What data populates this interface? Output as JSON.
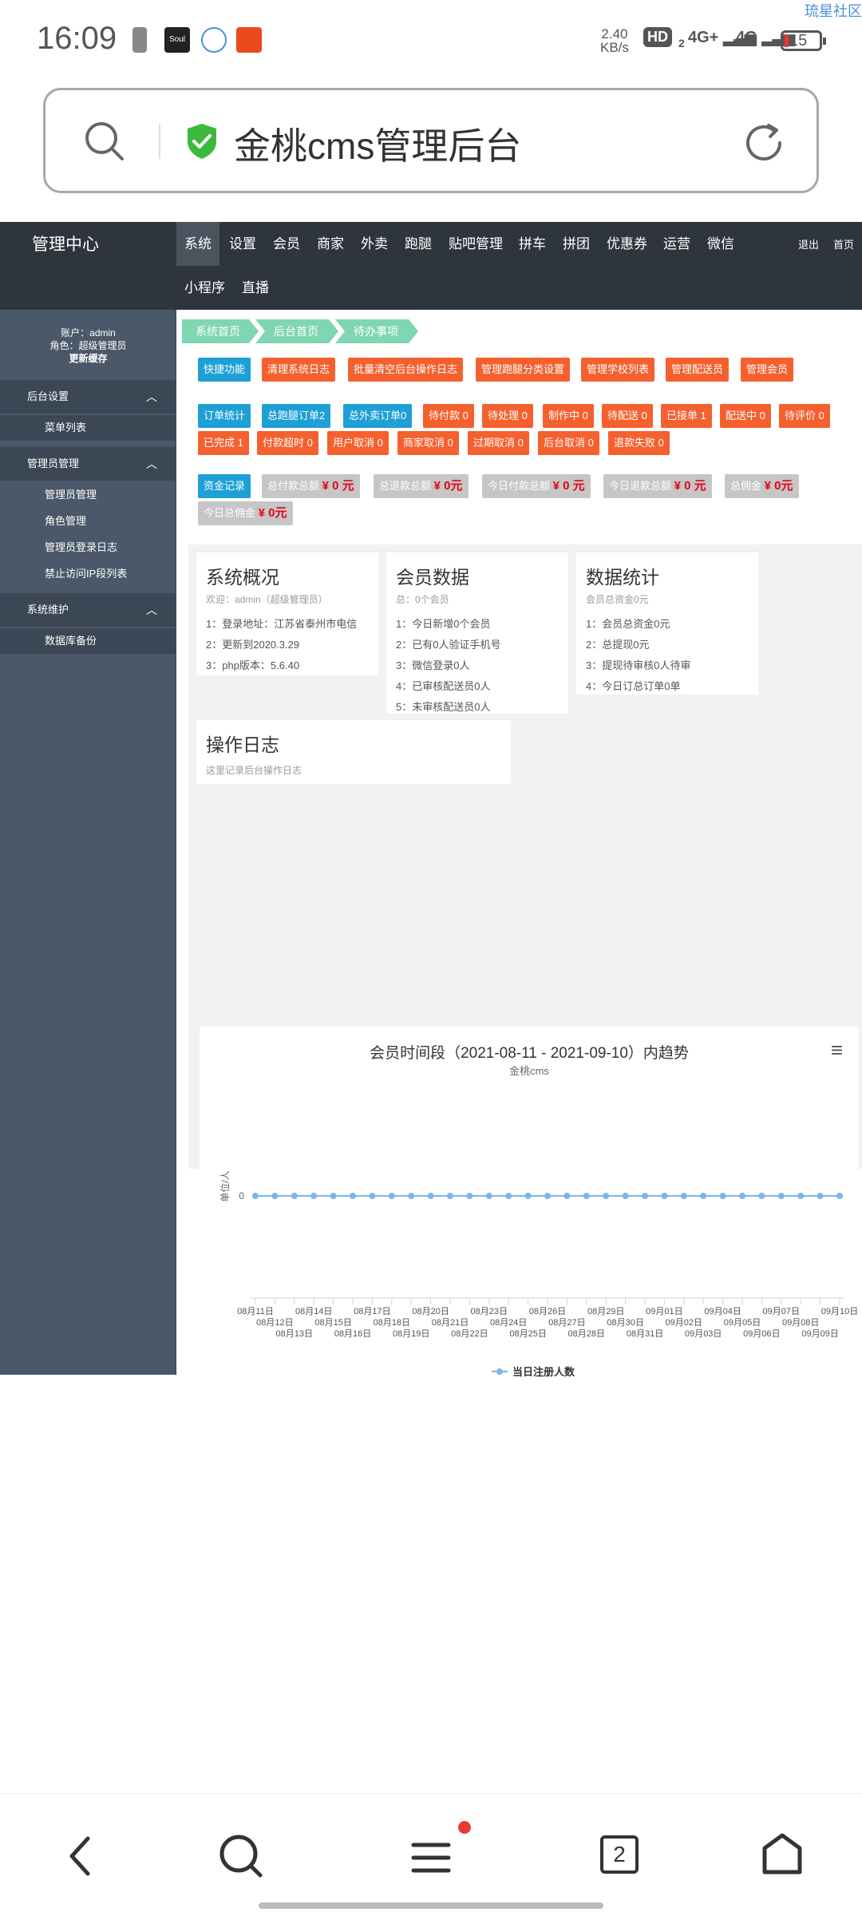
{
  "status_bar": {
    "time": "16:09",
    "app_icon_label": "Soul",
    "net_speed_value": "2.40",
    "net_speed_unit": "KB/s",
    "hd_label": "HD",
    "hd_sub": "2",
    "signal1": "4G+",
    "signal2": "4G",
    "battery": "15",
    "corner_link": "琉星社区"
  },
  "browser": {
    "url_title": "金桃cms管理后台",
    "tab_count": "2"
  },
  "header": {
    "brand": "管理中心",
    "nav": [
      "系统",
      "设置",
      "会员",
      "商家",
      "外卖",
      "跑腿",
      "贴吧管理",
      "拼车",
      "拼团",
      "优惠券",
      "运营",
      "微信"
    ],
    "nav_row2": [
      "小程序",
      "直播"
    ],
    "logout": "退出",
    "home": "首页"
  },
  "sidebar": {
    "account": "账户：admin",
    "role": "角色：超级管理员",
    "clear_cache": "更新缓存",
    "sections": [
      {
        "title": "后台设置",
        "items": [
          "菜单列表"
        ]
      },
      {
        "title": "管理员管理",
        "items": [
          "管理员管理",
          "角色管理",
          "管理员登录日志",
          "禁止访问IP段列表"
        ]
      },
      {
        "title": "系统维护",
        "items": [
          "数据库备份"
        ]
      }
    ]
  },
  "breadcrumbs": [
    "系统首页",
    "后台首页",
    "待办事项"
  ],
  "quick_buttons": [
    "快捷功能",
    "清理系统日志",
    "批量清空后台操作日志",
    "管理跑腿分类设置",
    "管理学校列表",
    "管理配送员",
    "管理会员"
  ],
  "order_buttons": [
    "订单统计",
    "总跑腿订单2",
    "总外卖订单0",
    "待付款 0",
    "待处理 0",
    "制作中 0",
    "待配送 0",
    "已接单 1",
    "配送中 0",
    "待评价 0",
    "已完成 1",
    "付款超时 0",
    "用户取消 0",
    "商家取消 0",
    "过期取消 0",
    "后台取消 0",
    "退款失败 0"
  ],
  "finance": {
    "label": "资金记录",
    "items": [
      {
        "label": "总付款总额",
        "value": "¥ 0 元"
      },
      {
        "label": "总退款总额",
        "value": "¥ 0元"
      },
      {
        "label": "今日付款总额",
        "value": "¥ 0 元"
      },
      {
        "label": "今日退款总额",
        "value": "¥ 0 元"
      },
      {
        "label": "总佣金",
        "value": "¥ 0元"
      },
      {
        "label": "今日总佣金",
        "value": "¥ 0元"
      }
    ]
  },
  "cards": {
    "system": {
      "title": "系统概况",
      "sub": "欢迎：admin（超级管理员）",
      "lines": [
        "1：登录地址：江苏省泰州市电信",
        "2：更新到2020.3.29",
        "3：php版本：5.6.40"
      ]
    },
    "member": {
      "title": "会员数据",
      "sub": "总：0个会员",
      "lines": [
        "1：今日新增0个会员",
        "2：已有0人验证手机号",
        "3：微信登录0人",
        "4：已审核配送员0人",
        "5：未审核配送员0人"
      ]
    },
    "stats": {
      "title": "数据统计",
      "sub": "会员总资金0元",
      "lines": [
        "1：会员总资金0元",
        "2：总提现0元",
        "3：提现待审核0人待审",
        "4：今日订总订单0单"
      ]
    },
    "log": {
      "title": "操作日志",
      "sub": "这里记录后台操作日志"
    }
  },
  "chart_data": {
    "type": "line",
    "title": "会员时间段（2021-08-11 - 2021-09-10）内趋势",
    "subtitle": "金桃cms",
    "ylabel": "单位/人",
    "y_tick": "0",
    "series": [
      {
        "name": "当日注册人数",
        "values": [
          0,
          0,
          0,
          0,
          0,
          0,
          0,
          0,
          0,
          0,
          0,
          0,
          0,
          0,
          0,
          0,
          0,
          0,
          0,
          0,
          0,
          0,
          0,
          0,
          0,
          0,
          0,
          0,
          0,
          0,
          0
        ],
        "color": "#7cb5ec"
      }
    ],
    "categories": [
      "08月11日",
      "08月12日",
      "08月13日",
      "08月14日",
      "08月15日",
      "08月16日",
      "08月17日",
      "08月18日",
      "08月19日",
      "08月20日",
      "08月21日",
      "08月22日",
      "08月23日",
      "08月24日",
      "08月25日",
      "08月26日",
      "08月27日",
      "08月28日",
      "08月29日",
      "08月30日",
      "08月31日",
      "09月01日",
      "09月02日",
      "09月03日",
      "09月04日",
      "09月05日",
      "09月06日",
      "09月07日",
      "09月08日",
      "09月09日",
      "09月10日"
    ],
    "ylim": [
      0,
      0
    ],
    "legend_position": "bottom"
  }
}
